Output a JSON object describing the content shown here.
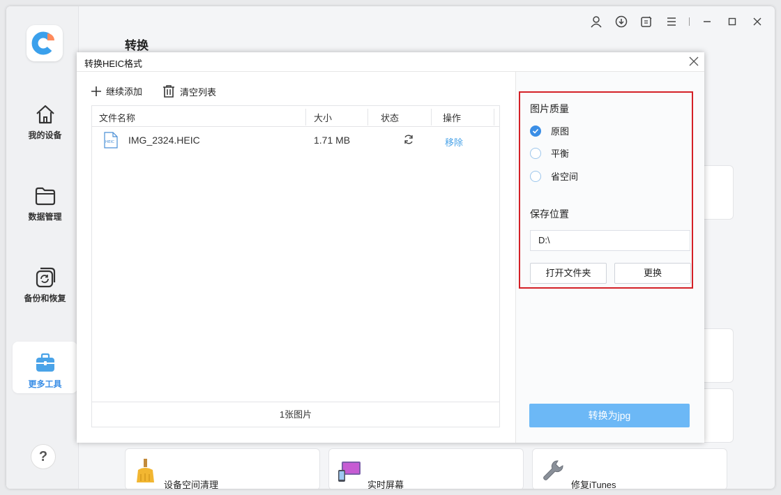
{
  "sidebar": {
    "items": [
      {
        "label": "我的设备",
        "icon": "home-icon"
      },
      {
        "label": "数据管理",
        "icon": "folder-icon"
      },
      {
        "label": "备份和恢复",
        "icon": "backup-restore-icon"
      },
      {
        "label": "更多工具",
        "icon": "toolbox-icon"
      }
    ],
    "help_label": "?"
  },
  "header": {
    "title": "转换",
    "controls": [
      "user-icon",
      "download-icon",
      "feedback-icon",
      "menu-icon",
      "minimize-icon",
      "maximize-icon",
      "close-icon"
    ]
  },
  "tools": [
    {
      "label": "设备空间清理",
      "icon": "broom-icon"
    },
    {
      "label": "实时屏幕",
      "icon": "screen-mirror-icon"
    },
    {
      "label": "修复iTunes",
      "icon": "wrench-icon"
    }
  ],
  "dialog": {
    "title": "转换HEIC格式",
    "add_more_label": "继续添加",
    "clear_list_label": "清空列表",
    "table": {
      "columns": [
        "文件名称",
        "大小",
        "状态",
        "操作"
      ],
      "rows": [
        {
          "file_type": "HEIC",
          "name": "IMG_2324.HEIC",
          "size": "1.71 MB",
          "status_icon": "refresh-icon",
          "action": "移除"
        }
      ],
      "footer": "1张图片"
    },
    "settings": {
      "quality_label": "图片质量",
      "quality_options": [
        {
          "label": "原图",
          "selected": true
        },
        {
          "label": "平衡",
          "selected": false
        },
        {
          "label": "省空间",
          "selected": false
        }
      ],
      "save_location_label": "保存位置",
      "save_path": "D:\\",
      "open_folder_label": "打开文件夹",
      "change_label": "更换"
    },
    "convert_label": "转换为jpg"
  },
  "colors": {
    "accent": "#3a8ee6",
    "convert_button": "#6cb8f6",
    "highlight_border": "#d42027",
    "link": "#4aa3e8"
  }
}
